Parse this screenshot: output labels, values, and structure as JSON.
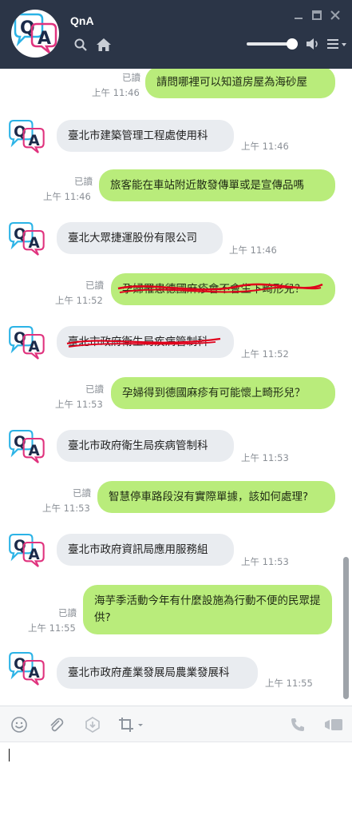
{
  "header": {
    "title": "QnA"
  },
  "messages": [
    {
      "side": "right",
      "read": "已讀",
      "time": "上午 11:46",
      "text": "請問哪裡可以知道房屋為海砂屋"
    },
    {
      "side": "left",
      "time": "上午 11:46",
      "text": "臺北市建築管理工程處使用科"
    },
    {
      "side": "right",
      "read": "已讀",
      "time": "上午 11:46",
      "text": "旅客能在車站附近散發傳單或是宣傳品嗎"
    },
    {
      "side": "left",
      "time": "上午 11:46",
      "text": "臺北大眾捷運股份有限公司"
    },
    {
      "side": "right",
      "read": "已讀",
      "time": "上午 11:52",
      "text": "孕婦罹患德國麻疹會不會生下畸形兒？"
    },
    {
      "side": "left",
      "time": "上午 11:52",
      "text": "臺北市政府衛生局疾病管制科"
    },
    {
      "side": "right",
      "read": "已讀",
      "time": "上午 11:53",
      "text": "孕婦得到德國麻疹有可能懷上畸形兒？"
    },
    {
      "side": "left",
      "time": "上午 11:53",
      "text": "臺北市政府衛生局疾病管制科"
    },
    {
      "side": "right",
      "read": "已讀",
      "time": "上午 11:53",
      "text": "智慧停車路段沒有實際單據，該如何處理?"
    },
    {
      "side": "left",
      "time": "上午 11:53",
      "text": "臺北市政府資訊局應用服務組"
    },
    {
      "side": "right",
      "read": "已讀",
      "time": "上午 11:55",
      "text": "海芋季活動今年有什麼設施為行動不便的民眾提供?"
    },
    {
      "side": "left",
      "time": "上午 11:55",
      "text": "臺北市政府產業發展局農業發展科"
    }
  ],
  "toolbar": {
    "icons": [
      "emoji-icon",
      "attach-icon",
      "keep-icon",
      "crop-icon",
      "call-icon",
      "video-icon"
    ]
  },
  "colors": {
    "header_bg": "#2b3547",
    "right_bubble": "#b9ec7b",
    "left_bubble": "#e9ecf0",
    "scribble": "#e0001b"
  }
}
